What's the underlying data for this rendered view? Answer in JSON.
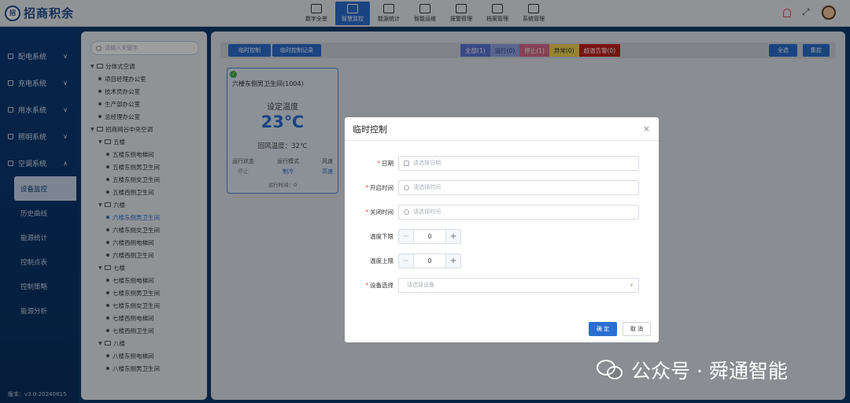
{
  "app": {
    "logo_text": "招商积余",
    "logo_badge": "招"
  },
  "topnav": [
    {
      "label": "数字全景",
      "icon": "screen-icon",
      "active": false
    },
    {
      "label": "智慧监控",
      "icon": "chart-icon",
      "active": true
    },
    {
      "label": "能源统计",
      "icon": "energy-icon",
      "active": false
    },
    {
      "label": "智能运维",
      "icon": "gear-icon",
      "active": false
    },
    {
      "label": "报警管理",
      "icon": "alarm-icon",
      "active": false
    },
    {
      "label": "档案管理",
      "icon": "archive-icon",
      "active": false
    },
    {
      "label": "系统管理",
      "icon": "settings-icon",
      "active": false
    }
  ],
  "sidebar": {
    "groups": [
      {
        "label": "配电系统",
        "chev": "∨"
      },
      {
        "label": "充电系统",
        "chev": "∨"
      },
      {
        "label": "用水系统",
        "chev": "∨"
      },
      {
        "label": "照明系统",
        "chev": "∨"
      },
      {
        "label": "空调系统",
        "chev": "∧"
      }
    ],
    "subitems": [
      "设备监控",
      "历史曲线",
      "能源统计",
      "控制点表",
      "控制策略",
      "能源分析"
    ],
    "version": "版本：v3.0-20240815"
  },
  "tree": {
    "search_placeholder": "请输入关键字",
    "rows": [
      {
        "text": "分体式空调",
        "type": "folder",
        "indent": 0
      },
      {
        "text": "项目经理办公室",
        "type": "leaf",
        "indent": 1
      },
      {
        "text": "技术员办公室",
        "type": "leaf",
        "indent": 1
      },
      {
        "text": "生产部办公室",
        "type": "leaf",
        "indent": 1
      },
      {
        "text": "总经理办公室",
        "type": "leaf",
        "indent": 1
      },
      {
        "text": "招商网谷中央空调",
        "type": "folder",
        "indent": 0
      },
      {
        "text": "五楼",
        "type": "folder",
        "indent": 1
      },
      {
        "text": "五楼东侧电梯间",
        "type": "leaf",
        "indent": 2
      },
      {
        "text": "五楼东侧男卫生间",
        "type": "leaf",
        "indent": 2
      },
      {
        "text": "五楼东侧女卫生间",
        "type": "leaf",
        "indent": 2
      },
      {
        "text": "五楼西侧卫生间",
        "type": "leaf",
        "indent": 2
      },
      {
        "text": "六楼",
        "type": "folder",
        "indent": 1
      },
      {
        "text": "六楼东侧男卫生间",
        "type": "leaf",
        "indent": 2,
        "selected": true
      },
      {
        "text": "六楼东侧女卫生间",
        "type": "leaf",
        "indent": 2
      },
      {
        "text": "六楼西侧电梯间",
        "type": "leaf",
        "indent": 2
      },
      {
        "text": "六楼西侧卫生间",
        "type": "leaf",
        "indent": 2
      },
      {
        "text": "七楼",
        "type": "folder",
        "indent": 1
      },
      {
        "text": "七楼东侧电梯间",
        "type": "leaf",
        "indent": 2
      },
      {
        "text": "七楼东侧男卫生间",
        "type": "leaf",
        "indent": 2
      },
      {
        "text": "七楼东侧女卫生间",
        "type": "leaf",
        "indent": 2
      },
      {
        "text": "七楼西侧电梯间",
        "type": "leaf",
        "indent": 2
      },
      {
        "text": "七楼西侧卫生间",
        "type": "leaf",
        "indent": 2
      },
      {
        "text": "八楼",
        "type": "folder",
        "indent": 1
      },
      {
        "text": "八楼东侧电梯间",
        "type": "leaf",
        "indent": 2
      },
      {
        "text": "八楼东侧男卫生间",
        "type": "leaf",
        "indent": 2
      }
    ]
  },
  "toolbar": {
    "temp_control": "临时控制",
    "temp_control_log": "临时控制记录",
    "filters": [
      {
        "label": "全部(1)",
        "color": "#5b76d6",
        "text_color": "#ffffff"
      },
      {
        "label": "运行(0)",
        "color": "#8ea3e6",
        "text_color": "#2a3d80"
      },
      {
        "label": "停止(1)",
        "color": "#d86b8a",
        "text_color": "#ffffff"
      },
      {
        "label": "异常(0)",
        "color": "#f2d655",
        "text_color": "#333333"
      },
      {
        "label": "超温告警(0)",
        "color": "#c4201c",
        "text_color": "#ffffff"
      }
    ],
    "select_all": "全选",
    "group_control": "集控"
  },
  "card": {
    "check": "✓",
    "title": "六楼东侧男卫生间(1004)",
    "set_label": "设定温度",
    "set_temp": "23℃",
    "return_temp": "回风温度：32℃",
    "stats": [
      {
        "label": "运行状态",
        "value": "停止",
        "gray": true
      },
      {
        "label": "运行模式",
        "value": "制冷",
        "gray": false
      },
      {
        "label": "风速",
        "value": "高速",
        "gray": false
      }
    ],
    "run_time": "运行时间：0"
  },
  "modal": {
    "title": "临时控制",
    "close": "×",
    "date_label": "日期",
    "date_placeholder": "请选择日期",
    "start_label": "开启时间",
    "start_placeholder": "请选择时间",
    "end_label": "关闭时间",
    "end_placeholder": "请选择时间",
    "temp_low_label": "温度下限",
    "temp_low_value": "0",
    "temp_high_label": "温度上限",
    "temp_high_value": "0",
    "device_label": "设备选择",
    "device_placeholder": "请选择设备",
    "ok": "确 定",
    "cancel": "取 消"
  },
  "watermark": {
    "text": "公众号 · 舜通智能"
  }
}
